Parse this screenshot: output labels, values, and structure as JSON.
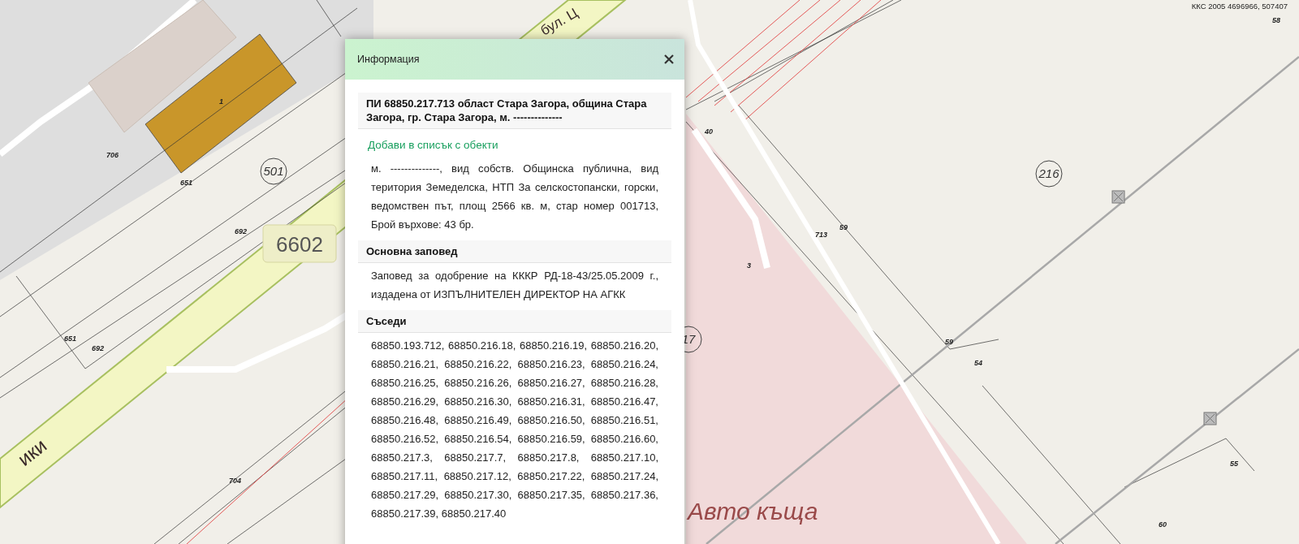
{
  "map": {
    "coordinates": "ККС 2005 4696966, 507407",
    "street_labels": [
      "бул. Ц",
      "ики"
    ],
    "place_label": "Авто къща",
    "road_number": "6602",
    "block_numbers": [
      "501",
      "216",
      "17"
    ],
    "parcel_numbers": [
      "1",
      "706",
      "651",
      "692",
      "651",
      "692",
      "704",
      "40",
      "3",
      "713",
      "59",
      "59",
      "54",
      "55",
      "60",
      "58"
    ]
  },
  "popup": {
    "title": "Информация",
    "property_heading": "ПИ 68850.217.713 област Стара Загора, община Стара Загора, гр. Стара Загора, м. --------------",
    "add_link": "Добави в списък с обекти",
    "description": "м. --------------, вид собств. Общинска публична, вид територия Земеделска, НТП За селскостопански, горски, ведомствен път, площ 2566 кв. м, стар номер 001713, Брой върхове: 43 бр.",
    "sections": [
      {
        "heading": "Основна заповед",
        "text": "Заповед за одобрение на КККР РД-18-43/25.05.2009 г., издадена от ИЗПЪЛНИТЕЛЕН ДИРЕКТОР НА АГКК"
      },
      {
        "heading": "Съседи",
        "text": "68850.193.712, 68850.216.18, 68850.216.19, 68850.216.20, 68850.216.21, 68850.216.22, 68850.216.23, 68850.216.24, 68850.216.25, 68850.216.26, 68850.216.27, 68850.216.28, 68850.216.29, 68850.216.30, 68850.216.31, 68850.216.47, 68850.216.48, 68850.216.49, 68850.216.50, 68850.216.51, 68850.216.52, 68850.216.54, 68850.216.59, 68850.216.60, 68850.217.3, 68850.217.7, 68850.217.8, 68850.217.10, 68850.217.11, 68850.217.12, 68850.217.22, 68850.217.24, 68850.217.29, 68850.217.30, 68850.217.35, 68850.217.36, 68850.217.39, 68850.217.40"
      }
    ]
  }
}
